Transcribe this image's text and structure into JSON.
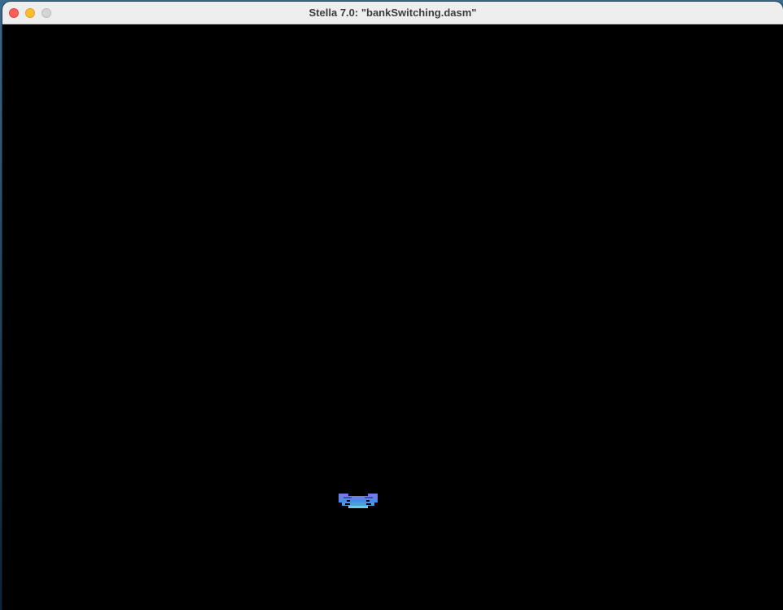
{
  "window": {
    "title": "Stella 7.0: \"bankSwitching.dasm\"",
    "buttons": {
      "close": "close",
      "minimize": "minimize",
      "zoom": "zoom"
    }
  },
  "screen": {
    "background_color": "#000000",
    "sprite": {
      "name": "player-sprite",
      "colors": {
        "top": "#6a7fe8",
        "middle": "#4a8ce0",
        "bottom": "#6ec8e8"
      }
    }
  }
}
